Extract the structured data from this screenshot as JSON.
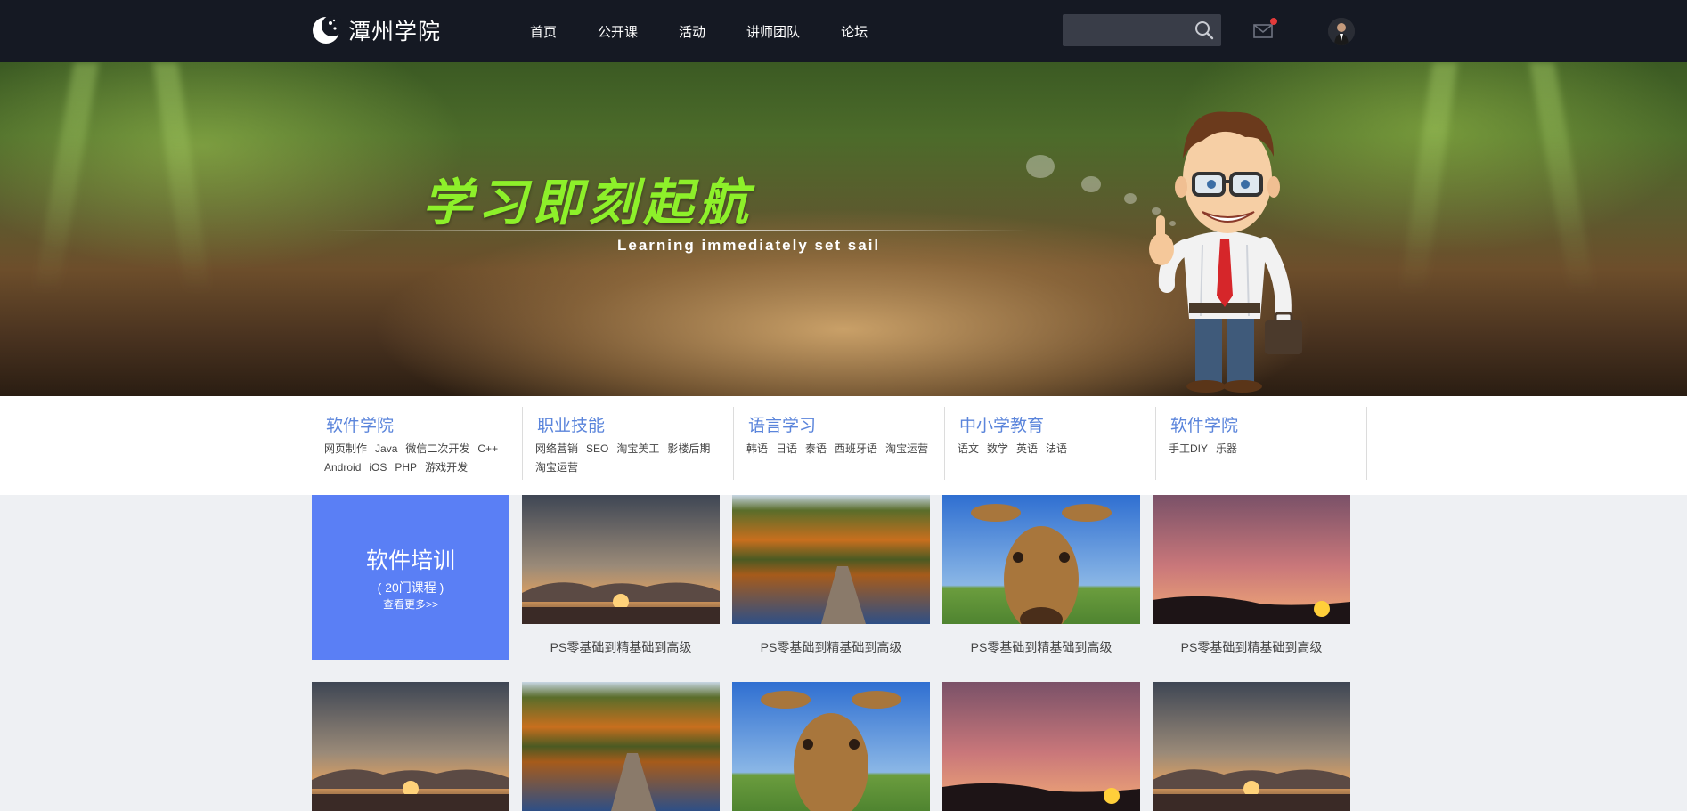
{
  "site": {
    "logo_text": "潭州学院"
  },
  "nav": [
    "首页",
    "公开课",
    "活动",
    "讲师团队",
    "论坛"
  ],
  "search": {
    "placeholder": ""
  },
  "banner": {
    "slogan": "学习即刻起航",
    "subslogan": "Learning immediately set sail"
  },
  "categories": [
    {
      "title": "软件学院",
      "links": [
        "网页制作",
        "Java",
        "微信二次开发",
        "C++",
        "Android",
        "iOS",
        "PHP",
        "游戏开发"
      ]
    },
    {
      "title": "职业技能",
      "links": [
        "网络营销",
        "SEO",
        "淘宝美工",
        "影楼后期",
        "淘宝运营"
      ]
    },
    {
      "title": "语言学习",
      "links": [
        "韩语",
        "日语",
        "泰语",
        "西班牙语",
        "淘宝运营"
      ]
    },
    {
      "title": "中小学教育",
      "links": [
        "语文",
        "数学",
        "英语",
        "法语"
      ]
    },
    {
      "title": "软件学院",
      "links": [
        "手工DIY",
        "乐器"
      ]
    }
  ],
  "feature": {
    "title": "软件培训",
    "count": "( 20门课程 )",
    "more": "查看更多>>"
  },
  "courses_row1": [
    {
      "thumb": "sunset-clouds",
      "caption": "PS零基础到精基础到高级"
    },
    {
      "thumb": "forest-lake-dock",
      "caption": "PS零基础到精基础到高级"
    },
    {
      "thumb": "giraffe",
      "caption": "PS零基础到精基础到高级"
    },
    {
      "thumb": "pink-sunset",
      "caption": "PS零基础到精基础到高级"
    }
  ],
  "courses_row2": [
    {
      "thumb": "sunset-clouds"
    },
    {
      "thumb": "forest-lake-dock"
    },
    {
      "thumb": "giraffe"
    },
    {
      "thumb": "pink-sunset"
    },
    {
      "thumb": "sunset-clouds"
    }
  ],
  "colors": {
    "header_bg": "#151923",
    "accent": "#5a7ff5",
    "category_title": "#5b85db",
    "slogan": "#8df02a"
  }
}
